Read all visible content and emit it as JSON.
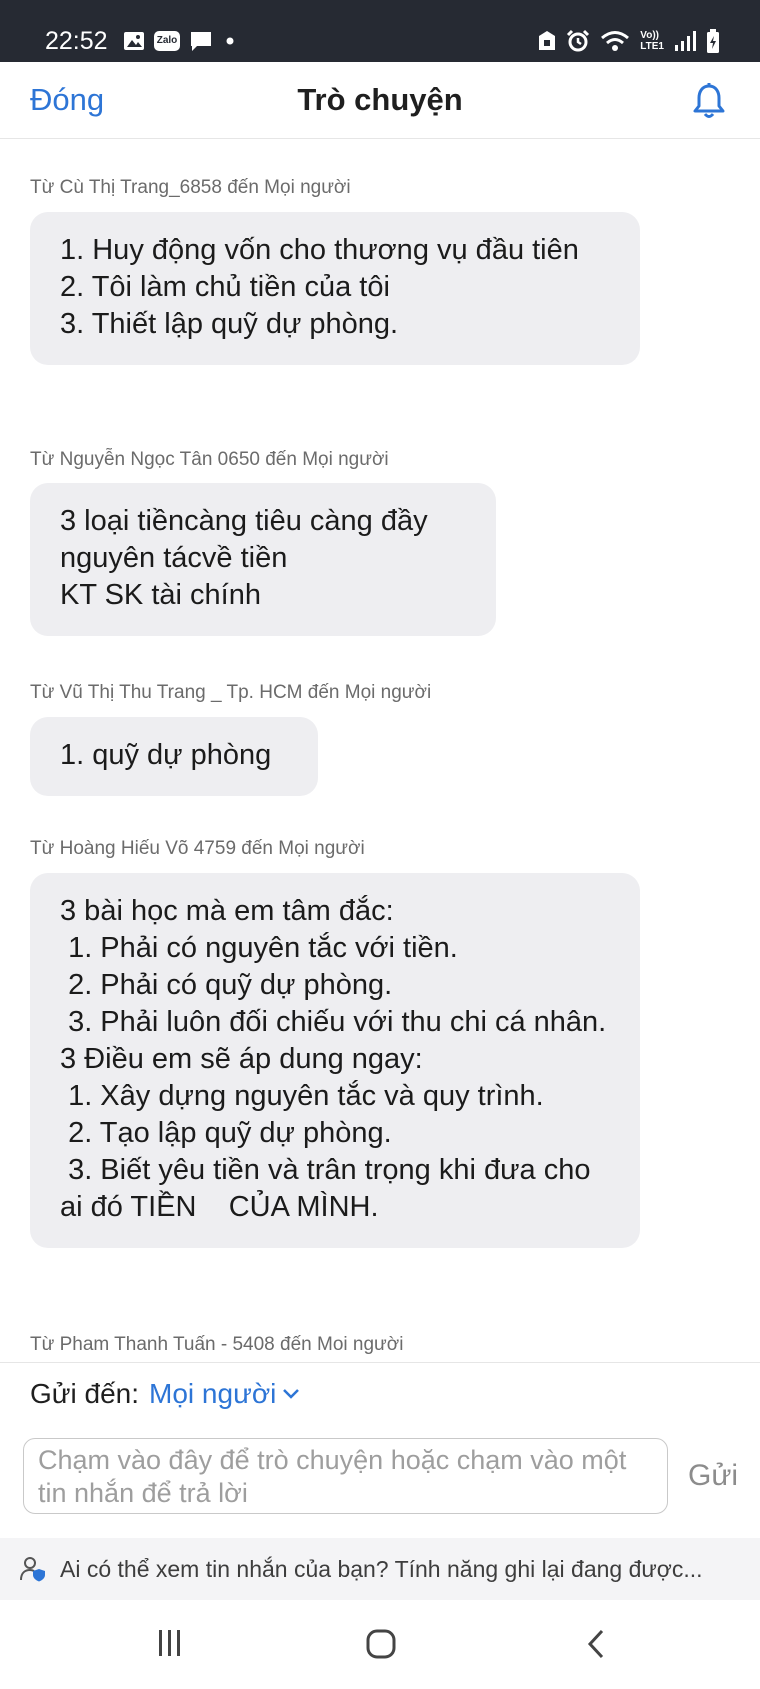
{
  "status_bar": {
    "time": "22:52",
    "notification_icons": [
      "image-icon",
      "zalo-icon",
      "message-icon",
      "dot-icon"
    ],
    "zalo_label": "Zalo",
    "system_icons": [
      "lock-icon",
      "alarm-icon",
      "wifi-icon",
      "volte-icon",
      "signal-icon",
      "battery-icon"
    ],
    "volte_top": "Vo))",
    "volte_bottom": "LTE1"
  },
  "header": {
    "close_label": "Đóng",
    "title": "Trò chuyện",
    "bell_icon": "bell-icon"
  },
  "messages": [
    {
      "sender": "Từ Cù Thị Trang_6858 đến Mọi người",
      "text": "1. Huy động vốn cho thương vụ đầu tiên\n2. Tôi làm chủ tiền của tôi\n3. Thiết lập quỹ dự phòng."
    },
    {
      "sender": "Từ Nguyễn Ngọc Tân 0650 đến Mọi người",
      "text": "3 loại tiềncàng tiêu càng đầy\nnguyên tácvề tiền\nKT SK tài chính"
    },
    {
      "sender": "Từ Vũ Thị Thu Trang _ Tp. HCM đến Mọi người",
      "text": "1. quỹ dự phòng"
    },
    {
      "sender": "Từ Hoàng Hiếu Võ 4759 đến Mọi người",
      "text": "3 bài học mà em tâm đắc:\n 1. Phải có nguyên tắc với tiền.\n 2. Phải có quỹ dự phòng.\n 3. Phải luôn đối chiếu với thu chi cá nhân.\n3 Điều em sẽ áp dung ngay:\n 1. Xây dựng nguyên tắc và quy trình.\n 2. Tạo lập quỹ dự phòng.\n 3. Biết yêu tiền và trân trọng khi đưa cho ai đó TIỀN    CỦA MÌNH."
    },
    {
      "sender": "Từ Pham Thanh Tuấn - 5408 đến Moi người",
      "text": ""
    }
  ],
  "compose": {
    "send_to_label": "Gửi đến:",
    "send_to_value": "Mọi người",
    "input_placeholder": "Chạm vào đây để trò chuyện hoặc chạm vào một tin nhắn để trả lời",
    "send_label": "Gửi"
  },
  "privacy_notice": "Ai có thể xem tin nhắn của bạn? Tính năng ghi lại đang được...",
  "nav_bar": {
    "icons": [
      "recents-icon",
      "home-icon",
      "back-icon"
    ]
  },
  "colors": {
    "accent": "#2d75d6",
    "status_bar": "#262a33",
    "bubble": "#eeeef1"
  }
}
